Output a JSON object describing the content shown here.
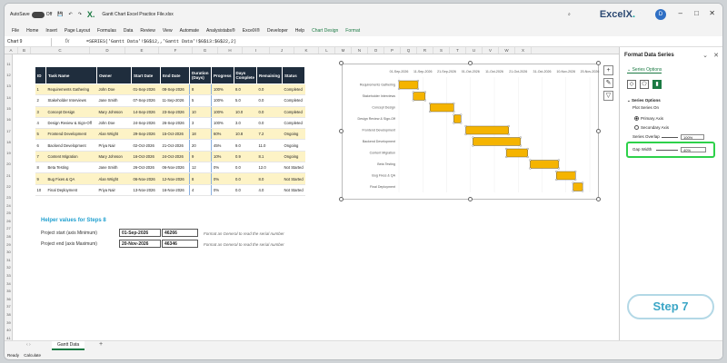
{
  "titlebar": {
    "autosave": "AutoSave",
    "autosave_state": "Off",
    "file_title": "Gantt Chart Excel Practice File.xlsx",
    "brand": "ExcelX",
    "brand_dot": ".",
    "avatar_initial": "D",
    "minimize": "–",
    "maximize": "□",
    "close": "✕"
  },
  "menu": [
    "File",
    "Home",
    "Insert",
    "Page Layout",
    "Formulas",
    "Data",
    "Review",
    "View",
    "Automate",
    "Analysistabs®",
    "ExcelX®",
    "Developer",
    "Help",
    "Chart Design",
    "Format"
  ],
  "menu_comments": "Comments",
  "menu_share": "Share",
  "formula_bar": {
    "name_box": "Chart 9",
    "fx": "fx",
    "formula": "=SERIES('Gantt Data'!$G$12,,'Gantt Data'!$G$13:$G$22,2)"
  },
  "columns": [
    "A",
    "B",
    "C",
    "D",
    "E",
    "F",
    "G",
    "H",
    "I",
    "J",
    "K",
    "L",
    "M",
    "N",
    "O",
    "P",
    "Q",
    "R",
    "S",
    "T",
    "U",
    "V",
    "W",
    "X"
  ],
  "rows": [
    "11",
    "12",
    "13",
    "14",
    "15",
    "16",
    "17",
    "18",
    "19",
    "20",
    "21",
    "22",
    "23",
    "24",
    "25",
    "26",
    "27",
    "28",
    "29",
    "30",
    "31",
    "32",
    "33",
    "34",
    "35",
    "36",
    "37",
    "38",
    "39",
    "40",
    "41"
  ],
  "table": {
    "headers": [
      "ID",
      "Task Name",
      "Owner",
      "Start Date",
      "End Date",
      "Duration (Days)",
      "Progress",
      "Days Complete",
      "Remaining",
      "Status"
    ],
    "rows": [
      [
        "1",
        "Requirements Gathering",
        "John Doe",
        "01-Sep-2026",
        "08-Sep-2026",
        "8",
        "100%",
        "8.0",
        "0.0",
        "Completed"
      ],
      [
        "2",
        "Stakeholder Interviews",
        "Jane Smith",
        "07-Sep-2026",
        "11-Sep-2026",
        "5",
        "100%",
        "5.0",
        "0.0",
        "Completed"
      ],
      [
        "3",
        "Concept Design",
        "Mary Johnson",
        "14-Sep-2026",
        "23-Sep-2026",
        "10",
        "100%",
        "10.0",
        "0.0",
        "Completed"
      ],
      [
        "4",
        "Design Review & Sign-Off",
        "John Doe",
        "24-Sep-2026",
        "26-Sep-2026",
        "3",
        "100%",
        "3.0",
        "0.0",
        "Completed"
      ],
      [
        "5",
        "Frontend Development",
        "Alan Wright",
        "29-Sep-2026",
        "15-Oct-2026",
        "18",
        "60%",
        "10.8",
        "7.2",
        "Ongoing"
      ],
      [
        "6",
        "Backend Development",
        "Priya Nair",
        "02-Oct-2026",
        "21-Oct-2026",
        "20",
        "45%",
        "9.0",
        "11.0",
        "Ongoing"
      ],
      [
        "7",
        "Content Migration",
        "Mary Johnson",
        "16-Oct-2026",
        "24-Oct-2026",
        "9",
        "10%",
        "0.9",
        "8.1",
        "Ongoing"
      ],
      [
        "8",
        "Beta Testing",
        "Jane Smith",
        "26-Oct-2026",
        "06-Nov-2026",
        "12",
        "0%",
        "0.0",
        "12.0",
        "Not Started"
      ],
      [
        "9",
        "Bug Fixes & QA",
        "Alan Wright",
        "06-Nov-2026",
        "12-Nov-2026",
        "8",
        "0%",
        "0.0",
        "8.0",
        "Not Started"
      ],
      [
        "10",
        "Final Deployment",
        "Priya Nair",
        "13-Nov-2026",
        "16-Nov-2026",
        "4",
        "0%",
        "0.0",
        "4.0",
        "Not Started"
      ]
    ]
  },
  "helper": {
    "title": "Helper values for Steps 8",
    "start_label": "Project start (axis Minimum)",
    "start_date": "01-Sep-2026",
    "start_serial": "46266",
    "end_label": "Project end (axis Maximum)",
    "end_date": "20-Nov-2026",
    "end_serial": "46346",
    "note": "Format as General to read the serial number"
  },
  "chart_data": {
    "type": "bar",
    "subtype": "gantt",
    "categories": [
      "Requirements Gathering",
      "Stakeholder Interviews",
      "Concept Design",
      "Design Review & Sign-Off",
      "Frontend Development",
      "Backend Development",
      "Content Migration",
      "Beta Testing",
      "Bug Fixes & QA",
      "Final Deployment"
    ],
    "series": [
      {
        "values": [
          8,
          5,
          10,
          3,
          18,
          20,
          9,
          12,
          8,
          4
        ],
        "color": "#f5b400"
      }
    ],
    "x_tick_labels": [
      "01-Sep-2026",
      "11-Sep-2026",
      "21-Sep-2026",
      "01-Oct-2026",
      "11-Oct-2026",
      "21-Oct-2026",
      "31-Oct-2026",
      "10-Nov-2026",
      "20-Nov-2026"
    ]
  },
  "panel": {
    "title": "Format Data Series",
    "close": "✕",
    "chevron": "⌄",
    "tab": "Series Options",
    "section": "Series Options",
    "plot_on": "Plot Series On",
    "primary": "Primary Axis",
    "secondary": "Secondary Axis",
    "overlap_label": "Series Overlap",
    "overlap_value": "100%",
    "gap_label": "Gap Width",
    "gap_value": "40%",
    "step_badge": "Step 7"
  },
  "sheet_tab": "Gantt Data",
  "add_sheet": "+",
  "status": {
    "ready": "Ready",
    "calculate": "Calculate"
  }
}
